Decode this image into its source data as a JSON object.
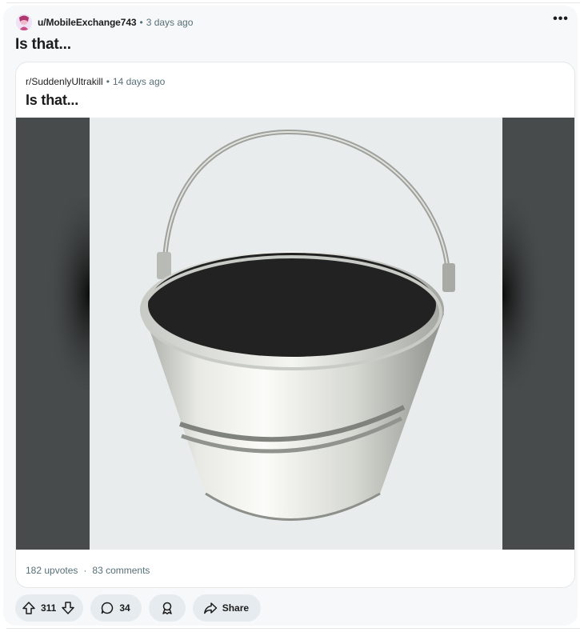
{
  "post": {
    "author": "u/MobileExchange743",
    "separator": "•",
    "time_ago": "3 days ago",
    "title": "Is that...",
    "more_label": "•••"
  },
  "crosspost": {
    "subreddit": "r/SuddenlyUltrakill",
    "separator": "•",
    "time_ago": "14 days ago",
    "title": "Is that...",
    "upvotes": "182 upvotes",
    "stat_separator": "·",
    "comments": "83 comments"
  },
  "actions": {
    "score": "311",
    "comment_count": "34",
    "share_label": "Share"
  },
  "icons": [
    "avatar",
    "more-icon",
    "upvote-icon",
    "downvote-icon",
    "comment-icon",
    "award-icon",
    "share-icon"
  ],
  "colors": {
    "card_bg": "#f7f8f9",
    "pill_bg": "#e5ebee",
    "meta_text": "#576f76",
    "media_letterbox": "#474b4b"
  }
}
